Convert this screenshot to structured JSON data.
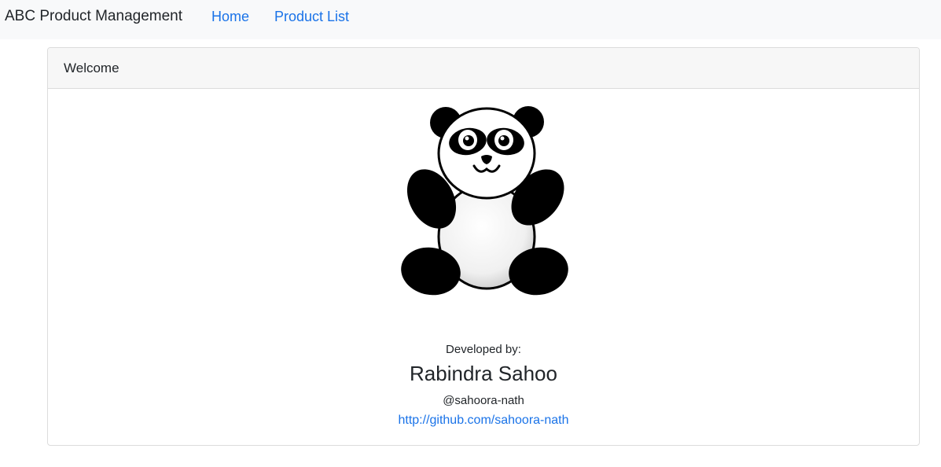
{
  "navbar": {
    "brand": "ABC Product Management",
    "links": [
      {
        "label": "Home"
      },
      {
        "label": "Product List"
      }
    ]
  },
  "card": {
    "header": "Welcome",
    "image": {
      "icon": "panda-illustration"
    },
    "developer": {
      "label": "Developed by:",
      "name": "Rabindra Sahoo",
      "handle": "@sahoora-nath",
      "url": "http://github.com/sahoora-nath"
    }
  },
  "colors": {
    "navbar_bg": "#f8f9fa",
    "link": "#1a73e8",
    "card_header_bg": "#f7f7f7",
    "border": "#dcdcdc"
  }
}
